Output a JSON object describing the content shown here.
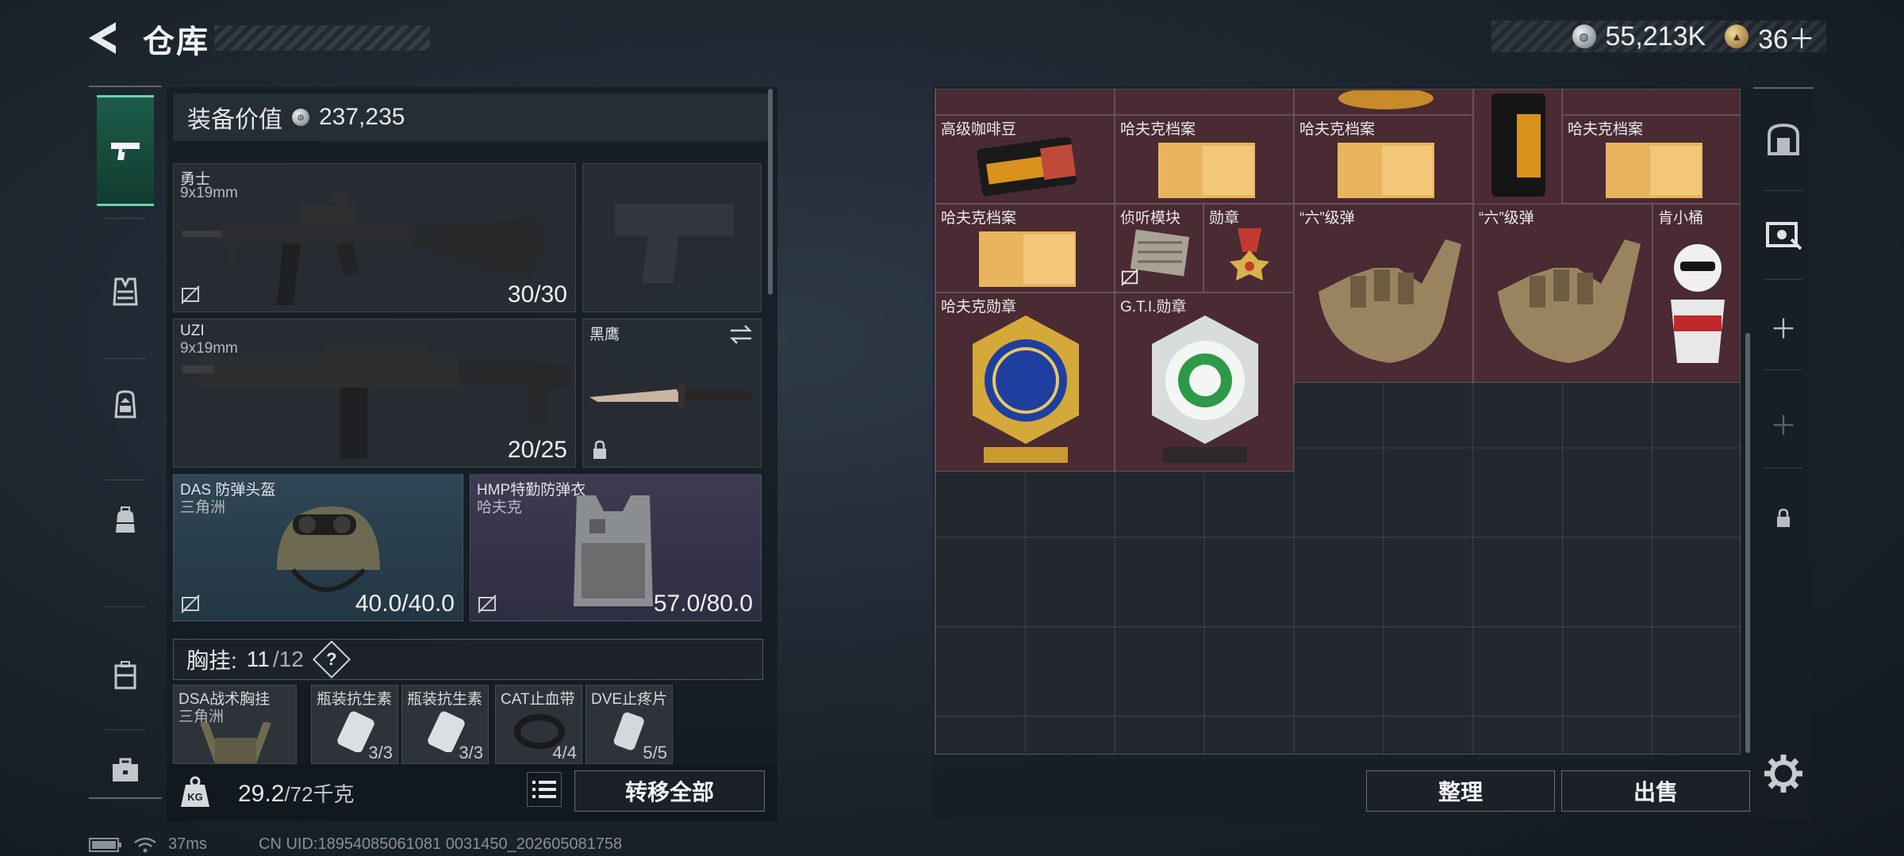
{
  "header": {
    "title": "仓库"
  },
  "currency": {
    "silver": "55,213K",
    "gold": "36＋"
  },
  "nav": {
    "items": [
      "pistol",
      "vest",
      "backpack-filled",
      "backpack",
      "case",
      "toolbox"
    ]
  },
  "equipment": {
    "value_label": "装备价值",
    "value": "237,235",
    "primary": {
      "name": "勇士",
      "caliber": "9x19mm",
      "ammo": "30/30"
    },
    "secondary": {
      "name": "UZI",
      "caliber": "9x19mm",
      "ammo": "20/25"
    },
    "melee": {
      "name": "黑鹰"
    },
    "helmet": {
      "name": "DAS 防弹头盔",
      "brand": "三角洲",
      "durability": "40.0/40.0"
    },
    "armor": {
      "name": "HMP特勤防弹衣",
      "brand": "哈夫克",
      "durability": "57.0/80.0"
    },
    "chest": {
      "label": "胸挂:",
      "used": "11",
      "capacity": "/12",
      "help": "?"
    },
    "chest_items": [
      {
        "name": "DSA战术胸挂",
        "sub": "三角洲",
        "count": ""
      },
      {
        "name": "瓶装抗生素",
        "sub": "",
        "count": "3/3"
      },
      {
        "name": "瓶装抗生素",
        "sub": "",
        "count": "3/3"
      },
      {
        "name": "CAT止血带",
        "sub": "",
        "count": "4/4"
      },
      {
        "name": "DVE止疼片",
        "sub": "",
        "count": "5/5"
      }
    ]
  },
  "weight": {
    "current": "29.2",
    "max": "/72千克"
  },
  "buttons": {
    "transfer_all": "转移全部",
    "sort": "整理",
    "sell": "出售"
  },
  "status": {
    "ping": "37ms",
    "uid": "CN UID:18954085061081 0031450_202605081758"
  },
  "storage": {
    "items": [
      {
        "label": "高级咖啡豆"
      },
      {
        "label": "哈夫克档案"
      },
      {
        "label": "哈夫克档案"
      },
      {
        "label": "哈夫克档案"
      },
      {
        "label": "哈夫克档案"
      },
      {
        "label": "侦听模块"
      },
      {
        "label": "勋章"
      },
      {
        "label": "“六”级弹"
      },
      {
        "label": "“六”级弹"
      },
      {
        "label": "肯小桶"
      },
      {
        "label": "哈夫克勋章"
      },
      {
        "label": "G.T.I.勋章"
      }
    ]
  },
  "colors": {
    "accent": "#6fd1b0",
    "item_bg": "#4a2a33"
  }
}
